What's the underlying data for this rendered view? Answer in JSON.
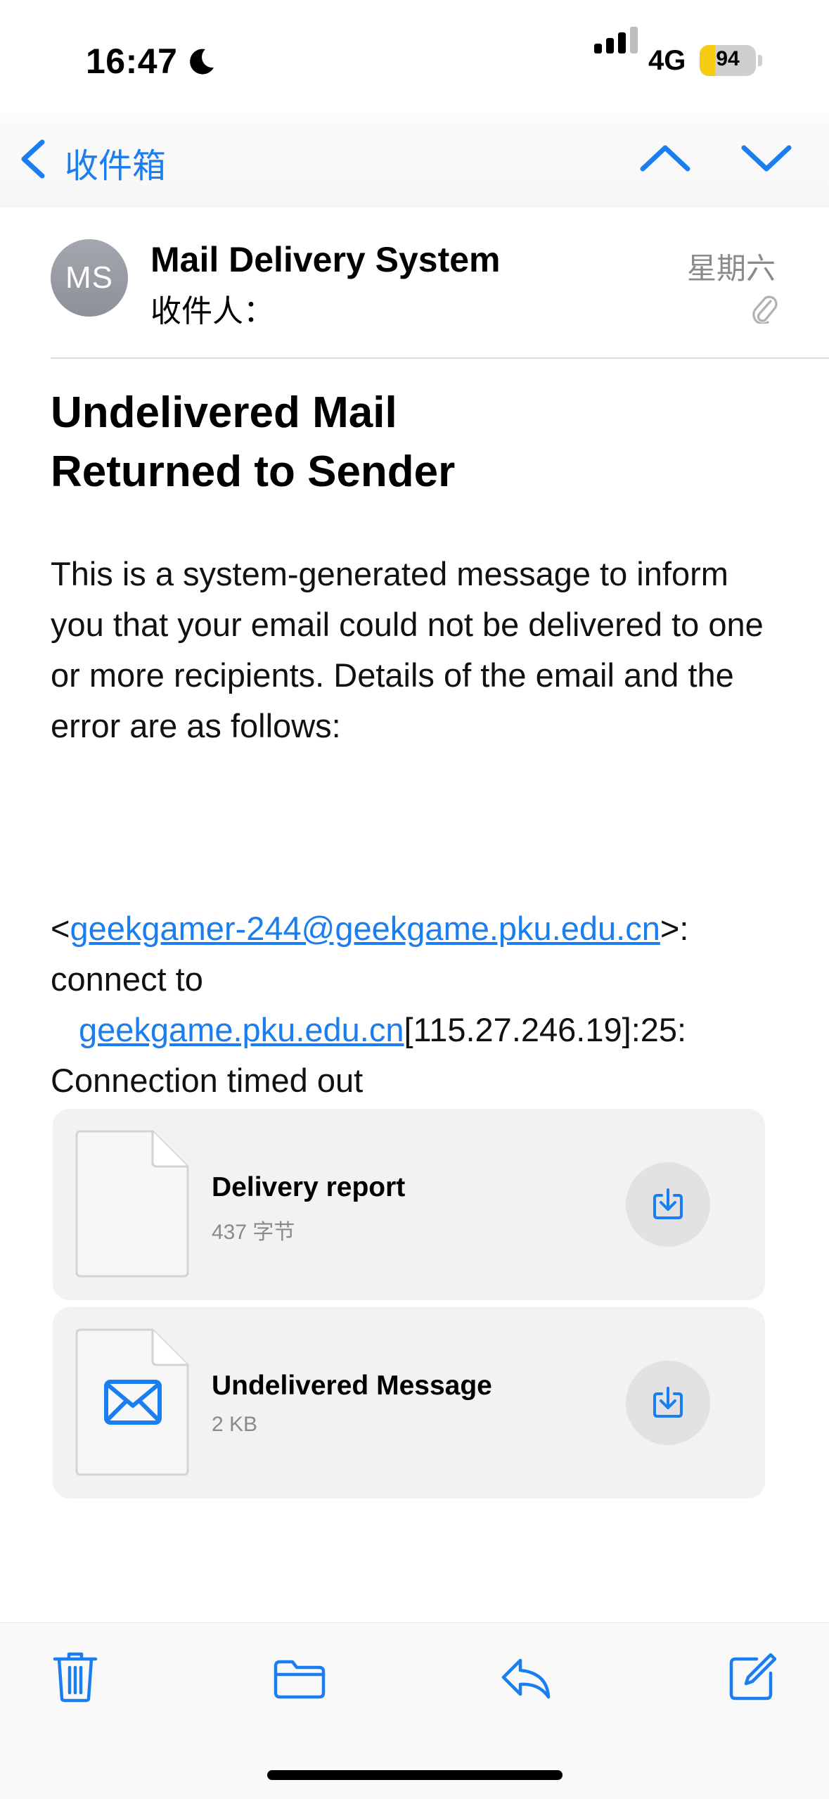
{
  "status_bar": {
    "time": "16:47",
    "moon_icon": "moon-icon",
    "network": "4G",
    "battery_level": "94",
    "signal_bars": 3
  },
  "nav": {
    "back_label": "收件箱",
    "icons": [
      "chevron-left-icon",
      "chevron-up-icon",
      "chevron-down-icon"
    ]
  },
  "email": {
    "avatar_initials": "MS",
    "sender": "Mail Delivery System",
    "recipient_label": "收件人：",
    "date": "星期六",
    "subject_line1": "Undelivered Mail",
    "subject_line2": "Returned to Sender",
    "body": "This is a system-generated message to inform you that your email could not be delivered to one or more recipients. Details of the email and the error are as follows:",
    "error": {
      "lt": "<",
      "address": "geekgamer-244@geekgame.pku.edu.cn",
      "gt": ">:",
      "connect_to": "connect to",
      "host": "geekgame.pku.edu.cn",
      "host_suffix": "[115.27.246.19]:25:",
      "timeout": "Connection timed out"
    }
  },
  "attachments": [
    {
      "name": "Delivery report",
      "size": "437 字节",
      "icon": "document-icon"
    },
    {
      "name": "Undelivered Message",
      "size": "2 KB",
      "icon": "envelope-icon"
    }
  ],
  "toolbar": {
    "icons": [
      "trash-icon",
      "folder-icon",
      "reply-icon",
      "compose-icon"
    ]
  },
  "colors": {
    "accent": "#1a7ef0",
    "battery": "#f5cc14",
    "avatar": "#999ca3"
  }
}
